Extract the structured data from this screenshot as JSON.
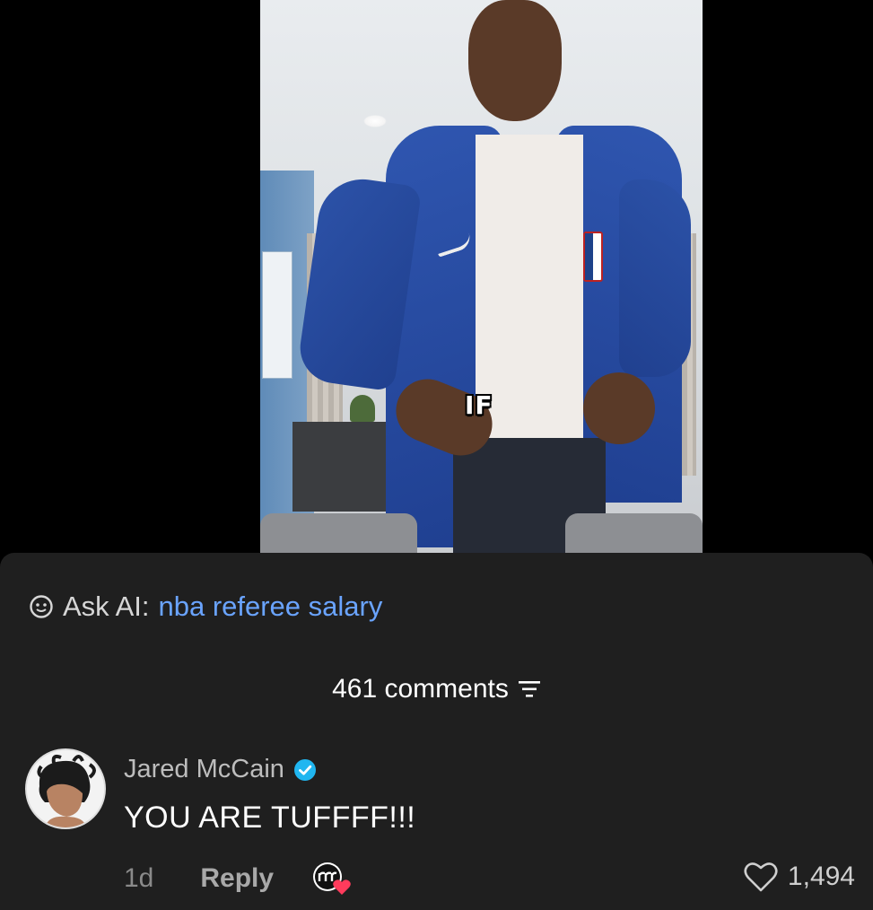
{
  "video": {
    "caption": "IF"
  },
  "ask_ai": {
    "label": "Ask AI:",
    "query": "nba referee salary",
    "icon": "ai-chat-icon"
  },
  "comments_header": {
    "count_text": "461 comments",
    "sort_icon": "sort-icon"
  },
  "comment": {
    "author": "Jared McCain",
    "verified": true,
    "text": "YOU ARE TUFFFF!!!",
    "time": "1d",
    "reply_label": "Reply",
    "likes": "1,494",
    "avatar_icon": "avatar",
    "creator_liked_icon": "creator-liked-icon"
  },
  "colors": {
    "panel_bg": "#1f1f1f",
    "link_blue": "#6aa4ff",
    "verified_blue": "#20b6f0"
  }
}
